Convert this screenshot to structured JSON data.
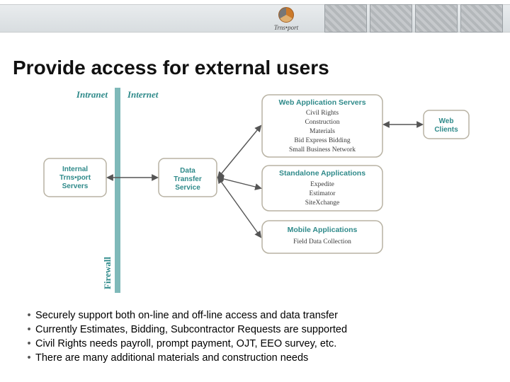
{
  "header": {
    "logo_text": "Trns•port"
  },
  "title": "Provide access for external users",
  "diagram": {
    "labels": {
      "intranet": "Intranet",
      "internet": "Internet",
      "firewall": "Firewall"
    },
    "boxes": {
      "internal": {
        "title": "Internal Trns•port Servers",
        "items": []
      },
      "dts": {
        "title": "Data Transfer Service",
        "items": []
      },
      "was": {
        "title": "Web Application Servers",
        "items": [
          "Civil Rights",
          "Construction",
          "Materials",
          "Bid Express Bidding",
          "Small Business Network"
        ]
      },
      "standalone": {
        "title": "Standalone Applications",
        "items": [
          "Expedite",
          "Estimator",
          "SiteXchange"
        ]
      },
      "mobile": {
        "title": "Mobile Applications",
        "items": [
          "Field Data Collection"
        ]
      },
      "clients": {
        "title": "Web Clients",
        "items": []
      }
    }
  },
  "bullets": [
    "Securely support both on-line and off-line access and data transfer",
    "Currently Estimates, Bidding, Subcontractor Requests are supported",
    "Civil Rights needs payroll, prompt payment, OJT, EEO survey, etc.",
    "There are many additional materials and construction needs"
  ],
  "colors": {
    "teal": "#2f8a8a",
    "box_stroke": "#b8b2a3",
    "box_title": "#2f8a8a",
    "item_text": "#3a3a3a"
  }
}
